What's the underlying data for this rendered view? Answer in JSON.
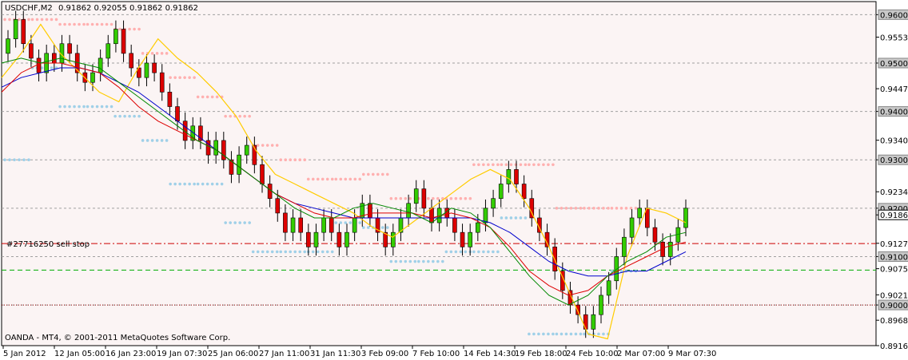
{
  "header": {
    "symbol": "USDCHF,M2",
    "ohlc": "0.91862 0.92055 0.91862 0.91862"
  },
  "footer": {
    "copyright": "OANDA - MT4, © 2001-2011 MetaQuotes Software Corp."
  },
  "order": {
    "label": "#27716250 sell stop",
    "price": 0.9072
  },
  "colors": {
    "background": "#ffffff",
    "plot_background": "#fbf4f4",
    "bull": "#33cc00",
    "bear": "#dd0000",
    "grid": "#a0a0a0",
    "ma_fast": "#008800",
    "ma_mid": "#dd0000",
    "ma_slow": "#0000cc",
    "channel": "#ffcc00",
    "resistance_dots": "#ffb0b0",
    "support_dots": "#a0d0e8",
    "order_line": "#00aa00",
    "current_level": "#cc0000"
  },
  "chart_data": {
    "type": "candlestick",
    "y_axis": {
      "min": 0.8916,
      "max": 0.9627,
      "tick_labels": [
        "0.96000",
        "0.95535",
        "0.95000",
        "0.94470",
        "0.94000",
        "0.93405",
        "0.93000",
        "0.92340",
        "0.92000",
        "0.91862",
        "0.91275",
        "0.91000",
        "0.90750",
        "0.90210",
        "0.90000",
        "0.89685",
        "0.89160"
      ],
      "highlighted_levels": [
        0.96,
        0.95,
        0.94,
        0.93,
        0.92,
        0.91,
        0.9
      ],
      "current_price": 0.91862
    },
    "x_axis": {
      "tick_labels": [
        "5 Jan 2012",
        "12 Jan 05:00",
        "16 Jan 23:00",
        "19 Jan 07:30",
        "25 Jan 06:00",
        "27 Jan 11:00",
        "31 Jan 11:30",
        "3 Feb 09:00",
        "7 Feb 10:00",
        "14 Feb 14:30",
        "19 Feb 18:00",
        "24 Feb 10:00",
        "2 Mar 07:00",
        "9 Mar 07:30"
      ]
    },
    "grid": "horizontal-dashed",
    "red_dashed_level": 0.9127,
    "red_dotted_level": 0.9,
    "candles": {
      "close": [
        0.955,
        0.959,
        0.954,
        0.951,
        0.948,
        0.952,
        0.95,
        0.954,
        0.952,
        0.948,
        0.946,
        0.948,
        0.951,
        0.954,
        0.957,
        0.952,
        0.949,
        0.947,
        0.95,
        0.948,
        0.944,
        0.941,
        0.938,
        0.934,
        0.937,
        0.934,
        0.931,
        0.934,
        0.93,
        0.927,
        0.931,
        0.933,
        0.929,
        0.925,
        0.922,
        0.919,
        0.915,
        0.918,
        0.915,
        0.912,
        0.915,
        0.918,
        0.915,
        0.912,
        0.915,
        0.918,
        0.921,
        0.918,
        0.915,
        0.912,
        0.915,
        0.918,
        0.921,
        0.924,
        0.92,
        0.917,
        0.92,
        0.918,
        0.915,
        0.912,
        0.915,
        0.917,
        0.92,
        0.922,
        0.925,
        0.928,
        0.925,
        0.922,
        0.918,
        0.915,
        0.912,
        0.907,
        0.903,
        0.9,
        0.898,
        0.895,
        0.898,
        0.902,
        0.905,
        0.91,
        0.914,
        0.918,
        0.92,
        0.916,
        0.913,
        0.91,
        0.913,
        0.916,
        0.92
      ]
    },
    "indicators": [
      {
        "kind": "moving-average-fast",
        "values": [
          0.95,
          0.951,
          0.95,
          0.951,
          0.95,
          0.949,
          0.946,
          0.943,
          0.94,
          0.937,
          0.934,
          0.932,
          0.929,
          0.926,
          0.923,
          0.92,
          0.918,
          0.918,
          0.92,
          0.921,
          0.92,
          0.919,
          0.917,
          0.92,
          0.919,
          0.916,
          0.911,
          0.906,
          0.902,
          0.9,
          0.902,
          0.906,
          0.909,
          0.911,
          0.914,
          0.915
        ]
      },
      {
        "kind": "moving-average-mid",
        "values": [
          0.944,
          0.948,
          0.95,
          0.95,
          0.949,
          0.948,
          0.945,
          0.941,
          0.938,
          0.936,
          0.934,
          0.932,
          0.929,
          0.926,
          0.923,
          0.921,
          0.919,
          0.918,
          0.918,
          0.919,
          0.919,
          0.919,
          0.918,
          0.919,
          0.918,
          0.916,
          0.912,
          0.907,
          0.904,
          0.902,
          0.903,
          0.906,
          0.908,
          0.91,
          0.912,
          0.913
        ]
      },
      {
        "kind": "moving-average-slow",
        "values": [
          0.945,
          0.947,
          0.948,
          0.949,
          0.949,
          0.948,
          0.946,
          0.944,
          0.941,
          0.938,
          0.935,
          0.932,
          0.929,
          0.926,
          0.923,
          0.921,
          0.92,
          0.919,
          0.918,
          0.918,
          0.918,
          0.918,
          0.918,
          0.918,
          0.918,
          0.917,
          0.915,
          0.912,
          0.909,
          0.907,
          0.906,
          0.906,
          0.907,
          0.907,
          0.909,
          0.911
        ]
      },
      {
        "kind": "price-channel",
        "values": [
          0.947,
          0.952,
          0.958,
          0.952,
          0.948,
          0.944,
          0.942,
          0.949,
          0.955,
          0.951,
          0.948,
          0.944,
          0.939,
          0.932,
          0.927,
          0.925,
          0.923,
          0.921,
          0.919,
          0.916,
          0.914,
          0.917,
          0.92,
          0.923,
          0.926,
          0.928,
          0.926,
          0.92,
          0.912,
          0.903,
          0.894,
          0.893,
          0.91,
          0.92,
          0.919,
          0.917
        ]
      },
      {
        "kind": "resistance-dots",
        "values": [
          0.959,
          0.959,
          0.958,
          0.958,
          0.957,
          0.952,
          0.947,
          0.943,
          0.939,
          0.933,
          0.93,
          0.926,
          0.926,
          0.927,
          0.922,
          0.922,
          0.922,
          0.929,
          0.929,
          0.929,
          0.92,
          0.92,
          0.92
        ]
      },
      {
        "kind": "support-dots",
        "values": [
          0.93,
          0.949,
          0.941,
          0.941,
          0.939,
          0.934,
          0.925,
          0.925,
          0.917,
          0.911,
          0.911,
          0.911,
          0.917,
          0.916,
          0.909,
          0.909,
          0.911,
          0.911,
          0.918,
          0.894,
          0.894,
          0.894,
          0.907
        ]
      }
    ]
  }
}
